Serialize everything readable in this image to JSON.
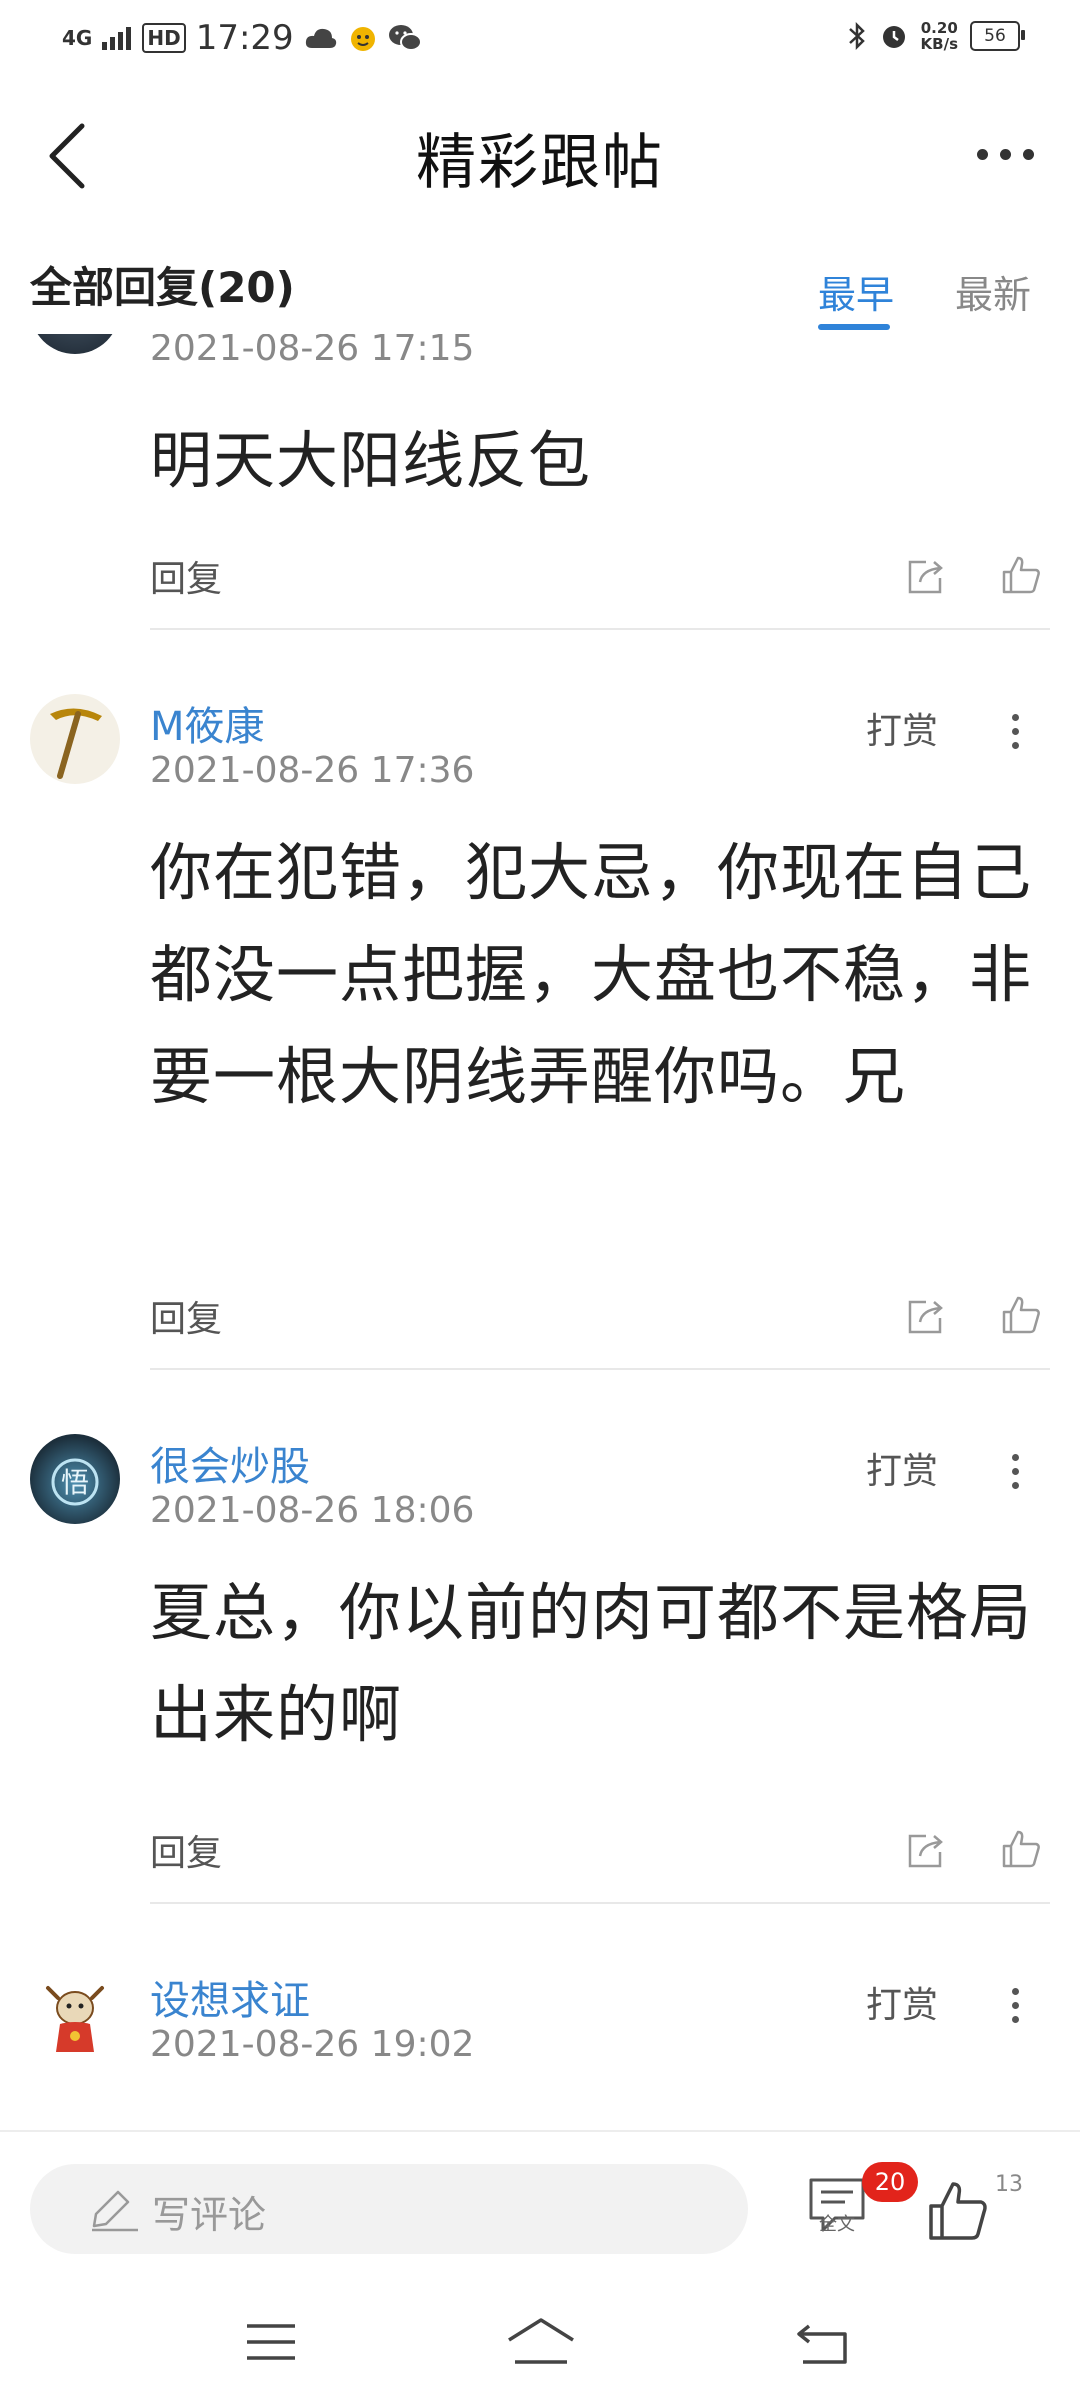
{
  "status_bar": {
    "network": "4G",
    "hd": "HD",
    "time": "17:29",
    "speed_value": "0.20",
    "speed_unit": "KB/s",
    "battery": "56"
  },
  "header": {
    "title": "精彩跟帖"
  },
  "filter": {
    "all_replies": "全部回复(20)",
    "sort_earliest": "最早",
    "sort_latest": "最新",
    "active_sort": "最早"
  },
  "replies": [
    {
      "time": "2021-08-26 17:15",
      "body": "明天大阳线反包",
      "reply_label": "回复"
    },
    {
      "name": "M筱康",
      "time": "2021-08-26 17:36",
      "tip_label": "打赏",
      "body": "你在犯错，犯大忌，你现在自己都没一点把握，大盘也不稳，非要一根大阴线弄醒你吗。兄",
      "reply_label": "回复"
    },
    {
      "name": "很会炒股",
      "time": "2021-08-26 18:06",
      "tip_label": "打赏",
      "body": "夏总，你以前的肉可都不是格局出来的啊",
      "reply_label": "回复",
      "avatar_char": "悟"
    },
    {
      "name": "设想求证",
      "time": "2021-08-26 19:02",
      "tip_label": "打赏"
    }
  ],
  "bottom_bar": {
    "comment_placeholder": "写评论",
    "fulltext_label": "全文",
    "comment_count": "20",
    "like_count": "13"
  },
  "colors": {
    "accent": "#2f83d9",
    "username": "#3a84cf",
    "badge": "#e2241b"
  }
}
